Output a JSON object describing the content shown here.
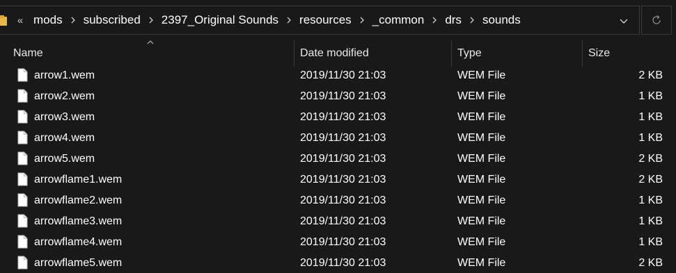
{
  "address_bar": {
    "overflow_label": "«",
    "breadcrumbs": [
      "mods",
      "subscribed",
      "2397_Original Sounds",
      "resources",
      "_common",
      "drs",
      "sounds"
    ]
  },
  "columns": {
    "name": "Name",
    "date_modified": "Date modified",
    "type": "Type",
    "size": "Size"
  },
  "files": [
    {
      "name": "arrow1.wem",
      "date": "2019/11/30 21:03",
      "type": "WEM File",
      "size": "2 KB"
    },
    {
      "name": "arrow2.wem",
      "date": "2019/11/30 21:03",
      "type": "WEM File",
      "size": "1 KB"
    },
    {
      "name": "arrow3.wem",
      "date": "2019/11/30 21:03",
      "type": "WEM File",
      "size": "1 KB"
    },
    {
      "name": "arrow4.wem",
      "date": "2019/11/30 21:03",
      "type": "WEM File",
      "size": "1 KB"
    },
    {
      "name": "arrow5.wem",
      "date": "2019/11/30 21:03",
      "type": "WEM File",
      "size": "2 KB"
    },
    {
      "name": "arrowflame1.wem",
      "date": "2019/11/30 21:03",
      "type": "WEM File",
      "size": "2 KB"
    },
    {
      "name": "arrowflame2.wem",
      "date": "2019/11/30 21:03",
      "type": "WEM File",
      "size": "1 KB"
    },
    {
      "name": "arrowflame3.wem",
      "date": "2019/11/30 21:03",
      "type": "WEM File",
      "size": "1 KB"
    },
    {
      "name": "arrowflame4.wem",
      "date": "2019/11/30 21:03",
      "type": "WEM File",
      "size": "1 KB"
    },
    {
      "name": "arrowflame5.wem",
      "date": "2019/11/30 21:03",
      "type": "WEM File",
      "size": "2 KB"
    }
  ],
  "colors": {
    "background": "#191919",
    "text": "#ffffff",
    "divider": "#3a3a3a",
    "folder": "#e8b84a"
  }
}
